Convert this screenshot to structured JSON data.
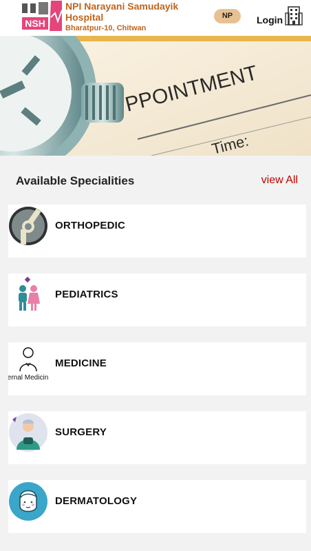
{
  "header": {
    "logo_text": "NSH",
    "hospital_name": "NPI Narayani Samudayik Hospital",
    "address": "Bharatpur-10, Chitwan",
    "lang_label": "NP",
    "login_label": "Login"
  },
  "banner": {
    "text_main": "PPOINTMENT",
    "text_time": "Time:"
  },
  "specialities": {
    "title": "Available Specialities",
    "view_all": "view All",
    "items": [
      {
        "label": "ORTHOPEDIC",
        "icon": "knee-joint-icon"
      },
      {
        "label": "PEDIATRICS",
        "icon": "children-icon"
      },
      {
        "label": "MEDICINE",
        "icon": "internal-medicine-icon",
        "icon_text": "ternal Medicin"
      },
      {
        "label": "SURGERY",
        "icon": "surgeon-icon"
      },
      {
        "label": "DERMATOLOGY",
        "icon": "face-skin-icon"
      }
    ]
  },
  "colors": {
    "brand": "#c0641c",
    "accent_red": "#c00000",
    "lang_bg": "#e8c192"
  }
}
